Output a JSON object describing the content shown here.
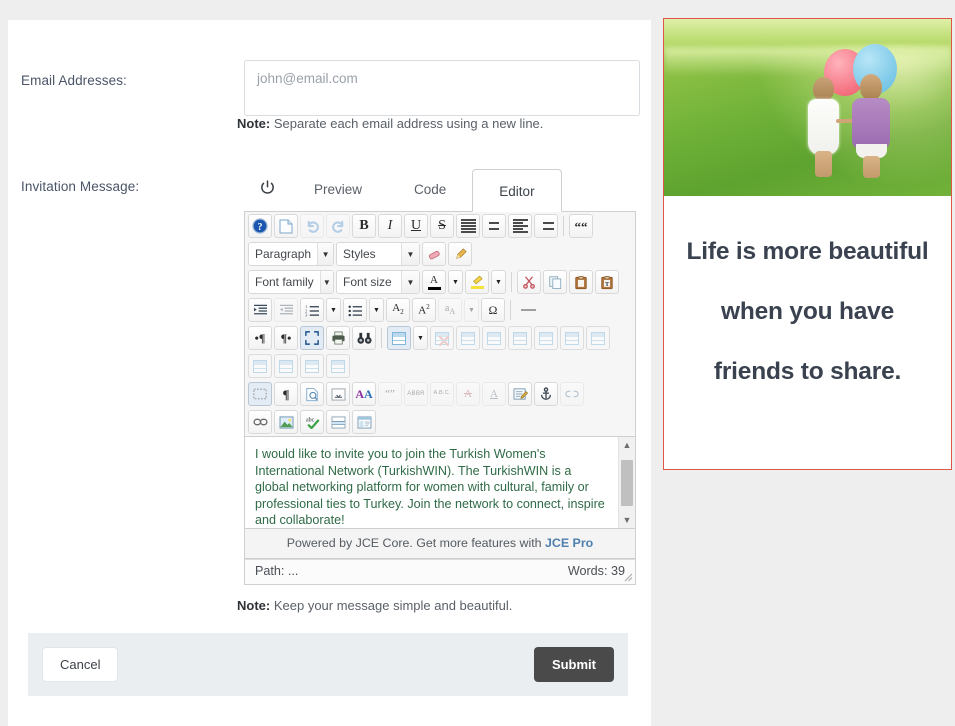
{
  "colors": {
    "page_background": "#eeeeee",
    "card_background": "#ffffff",
    "footer_background": "#eaeef1",
    "submit_button": "#4a4a4a",
    "promo_border": "#e0544a",
    "quote_text": "#3a4250",
    "editor_text": "#2f6b46",
    "link": "#4e7fae"
  },
  "form": {
    "email": {
      "label": "Email Addresses:",
      "value": "",
      "placeholder": "john@email.com",
      "note_prefix": "Note:",
      "note_text": "Separate each email address using a new line."
    },
    "message": {
      "label": "Invitation Message:",
      "note_prefix": "Note:",
      "note_text": "Keep your message simple and beautiful."
    }
  },
  "editor": {
    "power_icon": "power-icon",
    "tabs": [
      {
        "label": "Preview",
        "active": false
      },
      {
        "label": "Code",
        "active": false
      },
      {
        "label": "Editor",
        "active": true
      }
    ],
    "selects": {
      "paragraph": "Paragraph",
      "styles": "Styles",
      "font_family": "Font family",
      "font_size": "Font size"
    },
    "content": "I would like to invite you to join the Turkish Women's International Network (TurkishWIN). The TurkishWIN is a global networking platform for women with cultural, family or professional ties to Turkey. Join the network to connect, inspire and collaborate!",
    "promo_text": "Powered by JCE Core. Get more features with ",
    "promo_link": "JCE Pro",
    "status": {
      "path_label": "Path:",
      "path_value": "...",
      "words_label": "Words:",
      "words_value": "39"
    },
    "toolbar_rows": [
      {
        "name": "toolbar-row-1",
        "items": [
          {
            "name": "help-icon",
            "glyph": "?",
            "kind": "help"
          },
          {
            "name": "new-document-icon",
            "glyph": "❐",
            "kind": "page"
          },
          {
            "name": "undo-icon",
            "glyph": "↶",
            "kind": "undo",
            "disabled": true
          },
          {
            "name": "redo-icon",
            "glyph": "↷",
            "kind": "redo",
            "disabled": true
          },
          {
            "name": "bold-icon",
            "glyph": "B",
            "kind": "bold"
          },
          {
            "name": "italic-icon",
            "glyph": "I",
            "kind": "italic"
          },
          {
            "name": "underline-icon",
            "glyph": "U",
            "kind": "underline"
          },
          {
            "name": "strikethrough-icon",
            "glyph": "S",
            "kind": "strike"
          },
          {
            "name": "align-justify-icon",
            "glyph": "",
            "kind": "align-justify"
          },
          {
            "name": "align-center-icon",
            "glyph": "",
            "kind": "align-center"
          },
          {
            "name": "align-left-icon",
            "glyph": "",
            "kind": "align-left"
          },
          {
            "name": "align-right-icon",
            "glyph": "",
            "kind": "align-right"
          },
          {
            "name": "blockquote-icon",
            "glyph": "“",
            "kind": "quote"
          }
        ]
      },
      {
        "name": "toolbar-row-3",
        "items": [
          {
            "name": "eraser-icon",
            "glyph": "✎",
            "kind": "eraser"
          },
          {
            "name": "cleanup-icon",
            "glyph": "☂",
            "kind": "broom"
          }
        ]
      },
      {
        "name": "toolbar-row-5",
        "items": [
          {
            "name": "text-color-icon",
            "glyph": "A",
            "kind": "forecolor"
          },
          {
            "name": "highlight-color-icon",
            "glyph": "✏",
            "kind": "backcolor"
          },
          {
            "name": "cut-icon",
            "glyph": "✂",
            "kind": "cut"
          },
          {
            "name": "copy-icon",
            "glyph": "⧉",
            "kind": "copy"
          },
          {
            "name": "paste-icon",
            "glyph": "▤",
            "kind": "paste"
          },
          {
            "name": "paste-text-icon",
            "glyph": "T",
            "kind": "paste-text"
          }
        ]
      },
      {
        "name": "toolbar-row-6",
        "items": [
          {
            "name": "indent-icon",
            "glyph": "→",
            "kind": "indent"
          },
          {
            "name": "outdent-icon",
            "glyph": "←",
            "kind": "outdent",
            "disabled": true
          },
          {
            "name": "numbered-list-icon",
            "glyph": "1.",
            "kind": "ol"
          },
          {
            "name": "bullet-list-icon",
            "glyph": "•",
            "kind": "ul"
          },
          {
            "name": "subscript-icon",
            "glyph": "A₂",
            "kind": "sub"
          },
          {
            "name": "superscript-icon",
            "glyph": "A²",
            "kind": "sup"
          },
          {
            "name": "spellcheck-icon",
            "glyph": "a",
            "kind": "abbr",
            "disabled": true
          },
          {
            "name": "special-character-icon",
            "glyph": "Ω",
            "kind": "charmap"
          },
          {
            "name": "horizontal-rule-icon",
            "glyph": "—",
            "kind": "hr"
          }
        ]
      },
      {
        "name": "toolbar-row-7",
        "items": [
          {
            "name": "ltr-icon",
            "glyph": "¶",
            "kind": "ltr"
          },
          {
            "name": "rtl-icon",
            "glyph": "¶",
            "kind": "rtl"
          },
          {
            "name": "fullscreen-icon",
            "glyph": "⛶",
            "kind": "fullscreen",
            "selected": true
          },
          {
            "name": "print-icon",
            "glyph": "⎙",
            "kind": "print"
          },
          {
            "name": "search-replace-icon",
            "glyph": "🔭",
            "kind": "search"
          },
          {
            "name": "insert-table-icon",
            "glyph": "",
            "kind": "table"
          },
          {
            "name": "delete-table-icon",
            "glyph": "",
            "kind": "table-del",
            "disabled": true
          },
          {
            "name": "table-row-properties-icon",
            "glyph": "",
            "kind": "table-row",
            "disabled": true
          },
          {
            "name": "table-cell-properties-icon",
            "glyph": "",
            "kind": "table-cell",
            "disabled": true
          },
          {
            "name": "insert-row-before-icon",
            "glyph": "",
            "kind": "row-before",
            "disabled": true
          },
          {
            "name": "insert-row-after-icon",
            "glyph": "",
            "kind": "row-after",
            "disabled": true
          },
          {
            "name": "delete-row-icon",
            "glyph": "",
            "kind": "row-del",
            "disabled": true
          },
          {
            "name": "insert-column-before-icon",
            "glyph": "",
            "kind": "col-before",
            "disabled": true
          },
          {
            "name": "insert-column-after-icon",
            "glyph": "",
            "kind": "col-after",
            "disabled": true
          },
          {
            "name": "delete-column-icon",
            "glyph": "",
            "kind": "col-del",
            "disabled": true
          },
          {
            "name": "merge-cells-icon",
            "glyph": "",
            "kind": "merge",
            "disabled": true
          },
          {
            "name": "split-cells-icon",
            "glyph": "",
            "kind": "split",
            "disabled": true
          }
        ]
      },
      {
        "name": "toolbar-row-9",
        "items": [
          {
            "name": "visual-aid-icon",
            "glyph": "░",
            "kind": "visualaid",
            "selected": true
          },
          {
            "name": "visual-chars-icon",
            "glyph": "¶",
            "kind": "visualchars"
          },
          {
            "name": "preview-icon",
            "glyph": "⌕",
            "kind": "preview"
          },
          {
            "name": "page-break-icon",
            "glyph": "⎽",
            "kind": "pagebreak"
          },
          {
            "name": "article-icon",
            "glyph": "AA",
            "kind": "article"
          },
          {
            "name": "quote-icon",
            "glyph": "“”",
            "kind": "quotes",
            "disabled": true
          },
          {
            "name": "abbreviation-icon",
            "glyph": "ABBR",
            "kind": "abbr2",
            "disabled": true
          },
          {
            "name": "acronym-icon",
            "glyph": "A.B.C.",
            "kind": "acronym",
            "disabled": true
          },
          {
            "name": "delete-text-icon",
            "glyph": "A",
            "kind": "del",
            "disabled": true
          },
          {
            "name": "insert-text-icon",
            "glyph": "A",
            "kind": "ins",
            "disabled": true
          },
          {
            "name": "article-settings-icon",
            "glyph": "✎",
            "kind": "article2"
          },
          {
            "name": "anchor-icon",
            "glyph": "⚓",
            "kind": "anchor"
          },
          {
            "name": "unlink-icon",
            "glyph": "⛓",
            "kind": "unlink",
            "disabled": true
          },
          {
            "name": "link-icon",
            "glyph": "⚭",
            "kind": "link"
          },
          {
            "name": "image-icon",
            "glyph": "🖼",
            "kind": "image"
          },
          {
            "name": "spellchecker-icon",
            "glyph": "abc",
            "kind": "spell"
          },
          {
            "name": "readmore-icon",
            "glyph": "═",
            "kind": "readmore"
          },
          {
            "name": "template-icon",
            "glyph": "▧",
            "kind": "template"
          }
        ]
      }
    ]
  },
  "footer": {
    "cancel_label": "Cancel",
    "submit_label": "Submit"
  },
  "promo": {
    "image_name": "two-girls-with-balloons-photo",
    "quote": "Life is more beautiful when you have friends to share."
  }
}
